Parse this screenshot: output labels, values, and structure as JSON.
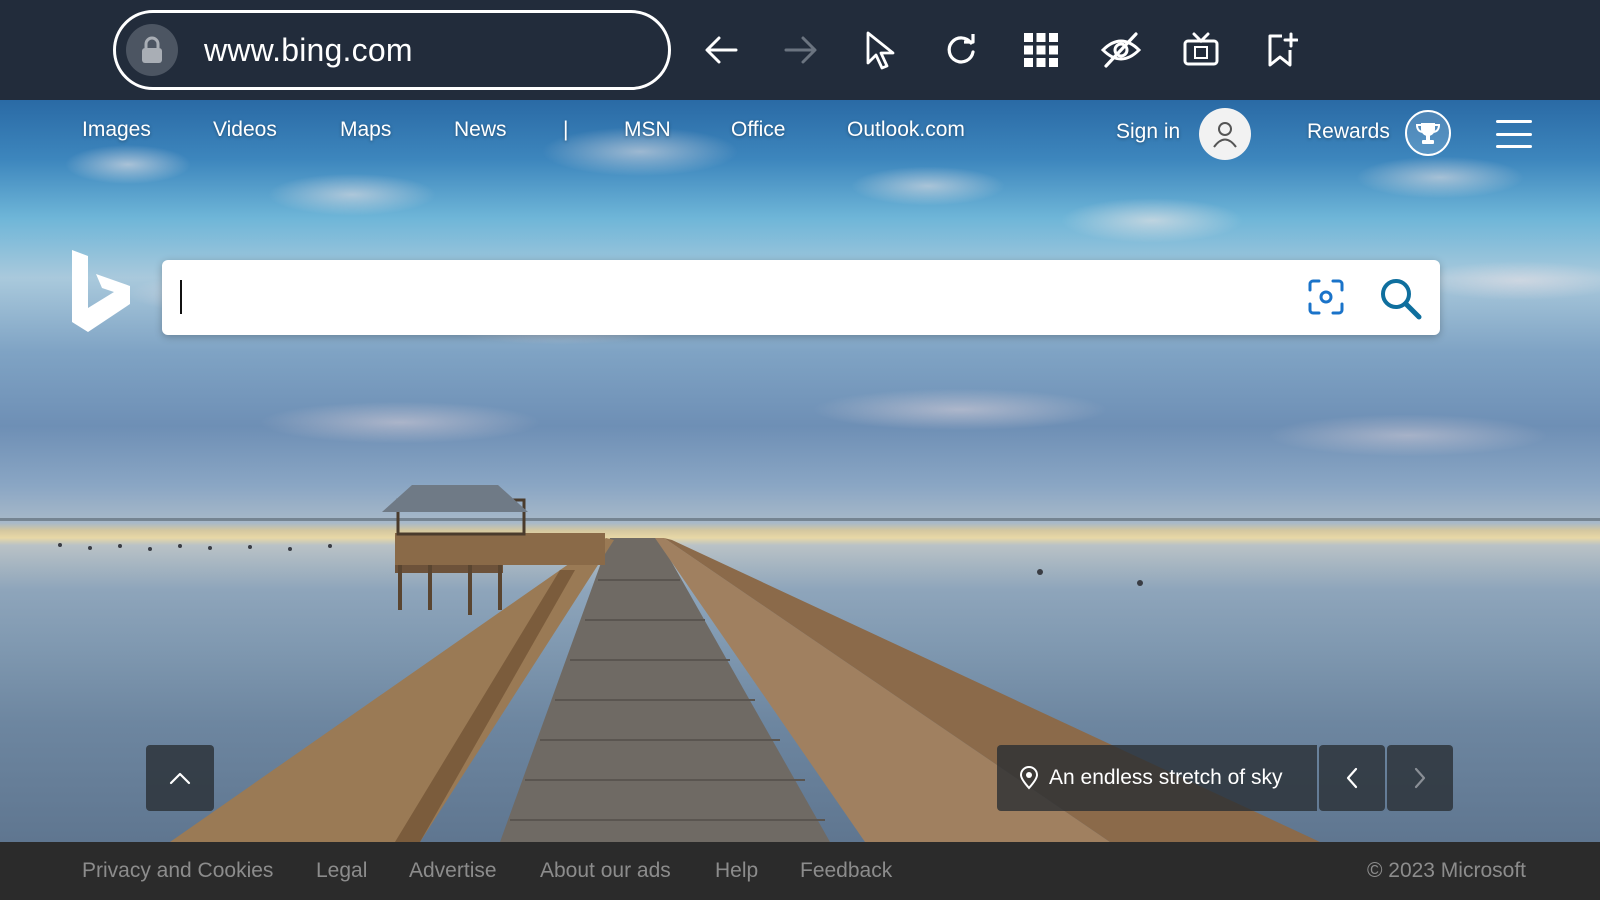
{
  "browser": {
    "url": "www.bing.com",
    "icons": [
      "lock-icon",
      "back-arrow-icon",
      "forward-arrow-icon",
      "cursor-icon",
      "reload-icon",
      "apps-grid-icon",
      "hide-eye-icon",
      "tv-icon",
      "bookmark-add-icon"
    ]
  },
  "nav": {
    "items": [
      {
        "label": "Images"
      },
      {
        "label": "Videos"
      },
      {
        "label": "Maps"
      },
      {
        "label": "News"
      },
      {
        "label": "|"
      },
      {
        "label": "MSN"
      },
      {
        "label": "Office"
      },
      {
        "label": "Outlook.com"
      }
    ],
    "sign_in": "Sign in",
    "rewards": "Rewards"
  },
  "search": {
    "value": "",
    "placeholder": ""
  },
  "caption": {
    "text": "An endless stretch of sky"
  },
  "footer": {
    "links": [
      {
        "label": "Privacy and Cookies"
      },
      {
        "label": "Legal"
      },
      {
        "label": "Advertise"
      },
      {
        "label": "About our ads"
      },
      {
        "label": "Help"
      },
      {
        "label": "Feedback"
      }
    ],
    "copyright": "© 2023 Microsoft"
  },
  "colors": {
    "toolbar_bg": "#222c3b",
    "footer_bg": "#2b2b2b",
    "search_icon": "#0f6f9e",
    "visual_search_icon": "#1a73c9"
  }
}
